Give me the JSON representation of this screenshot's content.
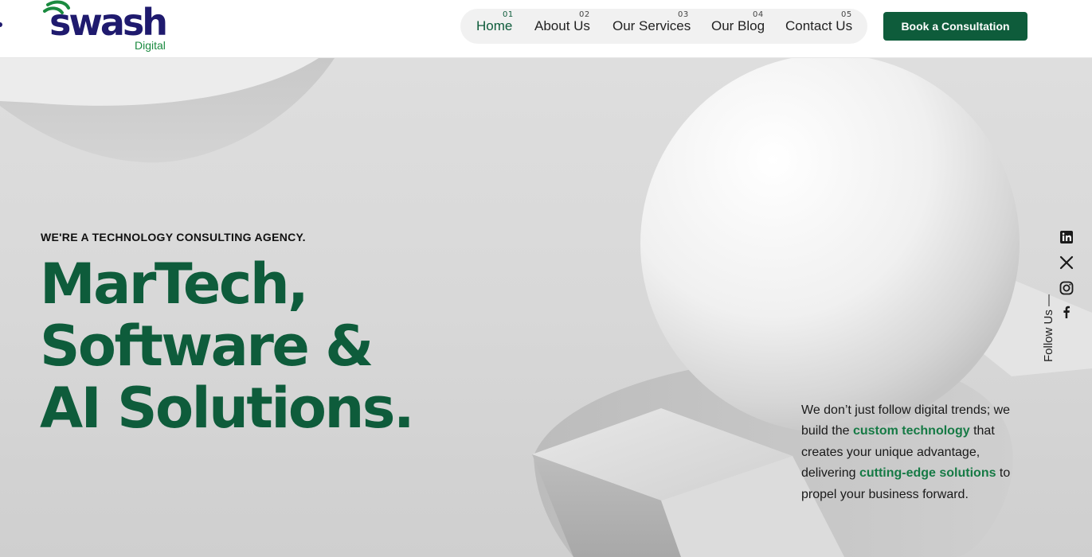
{
  "header": {
    "logo": {
      "word": "swash",
      "sub": "Digital"
    },
    "nav": [
      {
        "num": "01",
        "label": "Home",
        "active": true
      },
      {
        "num": "02",
        "label": "About Us",
        "active": false
      },
      {
        "num": "03",
        "label": "Our Services",
        "active": false
      },
      {
        "num": "04",
        "label": "Our Blog",
        "active": false
      },
      {
        "num": "05",
        "label": "Contact Us",
        "active": false
      }
    ],
    "cta_label": "Book a Consultation"
  },
  "hero": {
    "eyebrow": "WE'RE A TECHNOLOGY CONSULTING AGENCY.",
    "headline": [
      "MarTech,",
      "Software &",
      "AI Solutions."
    ],
    "blurb": {
      "part1": "We don’t just follow digital trends; we build the ",
      "highlight1": "custom technology",
      "part2": " that creates your unique advantage, delivering ",
      "highlight2": "cutting-edge solutions",
      "part3": " to propel your business forward."
    }
  },
  "social": {
    "label": "Follow Us —",
    "icons": [
      "linkedin-icon",
      "x-icon",
      "instagram-icon",
      "facebook-icon"
    ]
  },
  "colors": {
    "brand_green": "#0e5c3b",
    "highlight_green": "#167a45",
    "logo_navy": "#1f1a6e",
    "logo_sub_green": "#1a8a3f"
  }
}
